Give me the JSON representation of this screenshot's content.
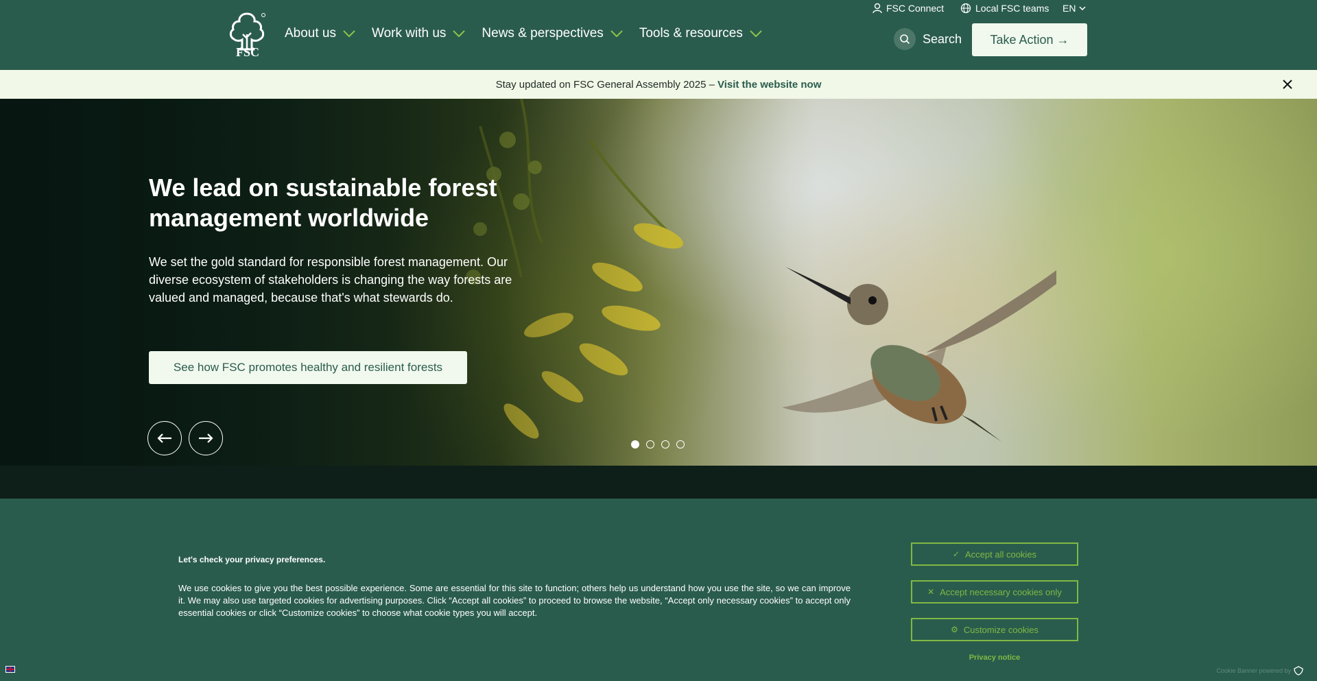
{
  "header": {
    "logo_text": "FSC",
    "nav": [
      {
        "label": "About us"
      },
      {
        "label": "Work with us"
      },
      {
        "label": "News & perspectives"
      },
      {
        "label": "Tools & resources"
      }
    ],
    "utility": {
      "connect": "FSC Connect",
      "local_teams": "Local FSC teams",
      "language": "EN"
    },
    "search_label": "Search",
    "take_action": "Take Action →"
  },
  "announcement": {
    "text": "Stay updated on FSC General Assembly 2025 –",
    "link": "Visit the website now"
  },
  "hero": {
    "title": "We lead on sustainable forest management worldwide",
    "text": "We set the gold standard for responsible forest management. Our diverse ecosystem of stakeholders is changing the way forests are valued and managed, because that's what stewards do.",
    "cta": "See how FSC promotes healthy and resilient forests",
    "slides_total": 4,
    "active_slide": 1
  },
  "cookie_banner": {
    "heading": "Let's check your privacy preferences.",
    "text": "We use cookies to give you the best possible experience. Some are essential for this site to function; others help us understand how you use the site, so we can improve it. We may also use targeted cookies for advertising purposes. Click “Accept all cookies” to proceed to browse the website, “Accept only necessary cookies” to accept only essential cookies or click “Customize cookies” to choose what cookie types you will accept.",
    "accept_all": "Accept all cookies",
    "accept_necessary": "Accept necessary cookies only",
    "customize": "Customize cookies",
    "privacy_notice": "Privacy notice",
    "powered_by": "Cookie Banner powered by"
  },
  "colors": {
    "brand_green": "#2a5c4d",
    "light_cream": "#f1f8ee",
    "accent_green": "#7fb944"
  }
}
